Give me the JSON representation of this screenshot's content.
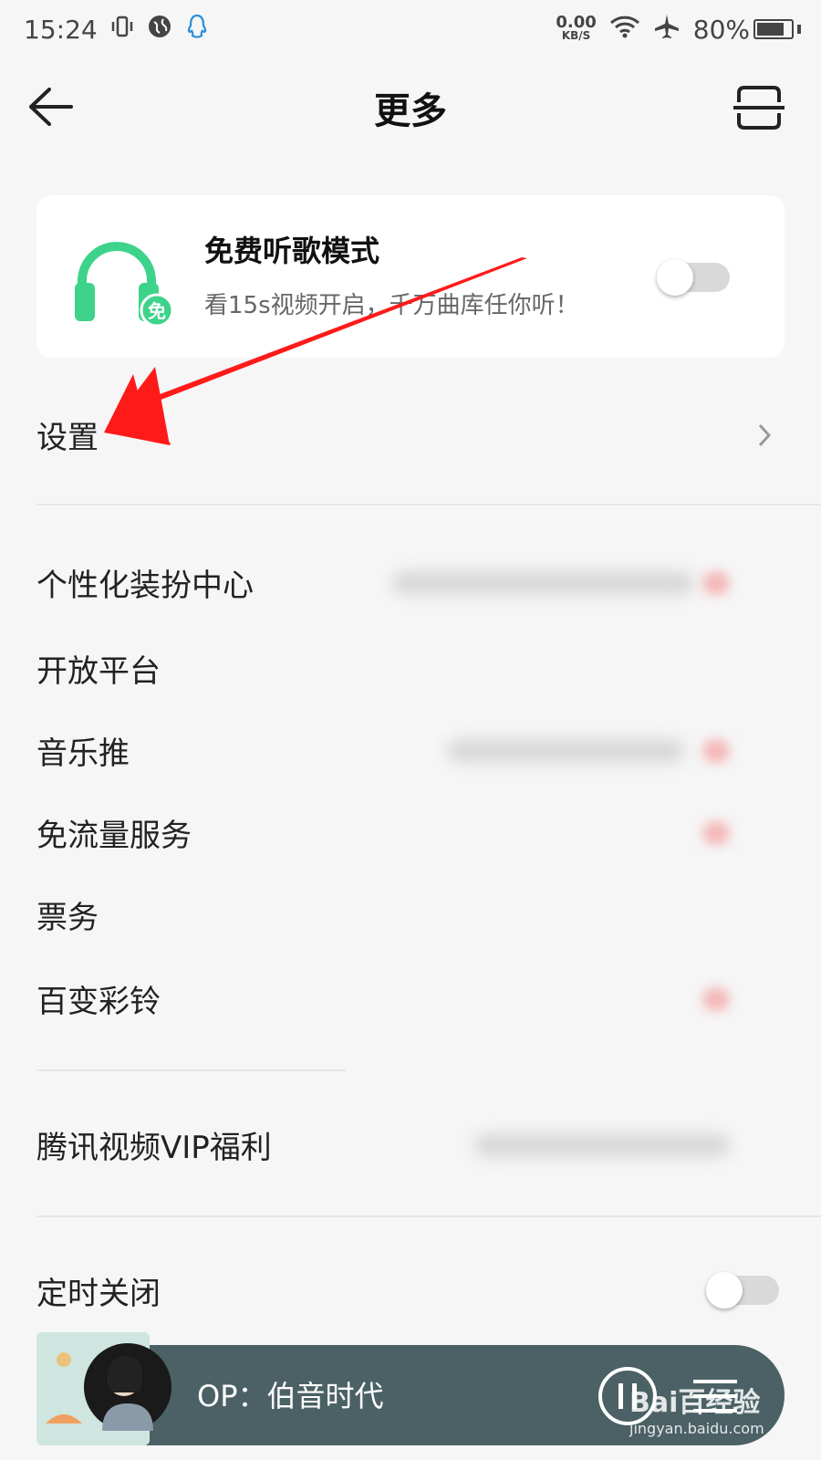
{
  "status_bar": {
    "time": "15:24",
    "net_speed_value": "0.00",
    "net_speed_unit": "KB/S",
    "battery": "80%"
  },
  "header": {
    "title": "更多"
  },
  "free_mode": {
    "title": "免费听歌模式",
    "subtitle": "看15s视频开启，千万曲库任你听！",
    "badge": "免",
    "enabled": false
  },
  "menu": {
    "settings": "设置",
    "theme_center": "个性化装扮中心",
    "open_platform": "开放平台",
    "music_push": "音乐推",
    "free_data": "免流量服务",
    "tickets": "票务",
    "ringtone": "百变彩铃",
    "tencent_video_vip": "腾讯视频VIP福利",
    "sleep_timer": "定时关闭"
  },
  "player": {
    "song": "OP：伯音时代"
  },
  "watermark": {
    "brand": "Bai百经验",
    "url": "jingyan.baidu.com"
  },
  "colors": {
    "accent_green": "#3ed38a",
    "arrow_red": "#ff1a1a",
    "player_bg": "#4b6165"
  }
}
